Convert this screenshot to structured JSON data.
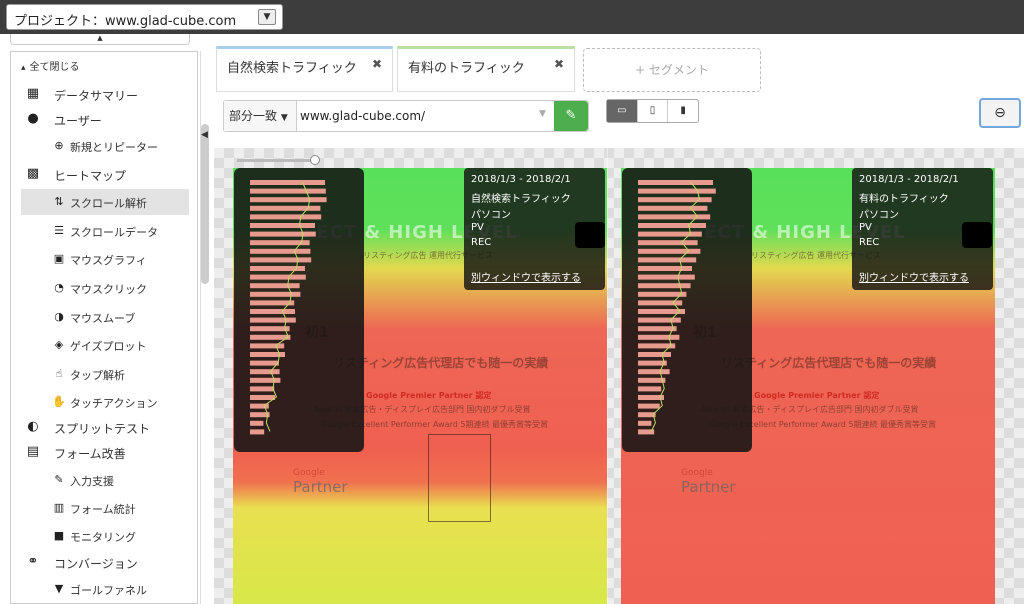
{
  "project_selector": {
    "label": "プロジェクト：www.glad-cube.com"
  },
  "sidebar": {
    "collapse_all": "全て閉じる",
    "items": [
      {
        "label": "データサマリー",
        "icon": "building-icon"
      },
      {
        "label": "ユーザー",
        "icon": "user-icon"
      },
      {
        "label": "新規とリピーター",
        "icon": "user-add-icon"
      },
      {
        "label": "ヒートマップ",
        "icon": "heatmap-icon"
      },
      {
        "label": "スクロール解析",
        "icon": "scroll-icon"
      },
      {
        "label": "スクロールデータ",
        "icon": "scroll-data-icon"
      },
      {
        "label": "マウスグラフィ",
        "icon": "mouse-graph-icon"
      },
      {
        "label": "マウスクリック",
        "icon": "mouse-click-icon"
      },
      {
        "label": "マウスムーブ",
        "icon": "mouse-move-icon"
      },
      {
        "label": "ゲイズプロット",
        "icon": "gaze-icon"
      },
      {
        "label": "タップ解析",
        "icon": "tap-icon"
      },
      {
        "label": "タッチアクション",
        "icon": "touch-icon"
      },
      {
        "label": "スプリットテスト",
        "icon": "toggle-icon"
      },
      {
        "label": "フォーム改善",
        "icon": "form-icon"
      },
      {
        "label": "入力支援",
        "icon": "input-assist-icon"
      },
      {
        "label": "フォーム統計",
        "icon": "form-stats-icon"
      },
      {
        "label": "モニタリング",
        "icon": "monitor-icon"
      },
      {
        "label": "コンバージョン",
        "icon": "handshake-icon"
      },
      {
        "label": "ゴールファネル",
        "icon": "funnel-icon"
      }
    ]
  },
  "segments": {
    "tabs": [
      {
        "label": "自然検索トラフィック",
        "accent": "#a7cfea"
      },
      {
        "label": "有料のトラフィック",
        "accent": "#b8e0a0"
      }
    ],
    "add_label": "+ セグメント"
  },
  "filter": {
    "mode": "部分一致",
    "url": "www.glad-cube.com/"
  },
  "panels": [
    {
      "date": "2018/1/3 - 2018/2/1",
      "segment": "自然検索トラフィック",
      "device": "パソコン",
      "metric1": "PV",
      "metric2": "REC",
      "link": "別ウィンドウで表示する"
    },
    {
      "date": "2018/1/3 - 2018/2/1",
      "segment": "有料のトラフィック",
      "device": "パソコン",
      "metric1": "PV",
      "metric2": "REC",
      "link": "別ウィンドウで表示する"
    }
  ],
  "page_preview": {
    "hero": "FECT & HIGH LEVEL",
    "hero_sub": "リスティング広告 運用代行サービス",
    "headline": "リスティング広告代理店でも随一の実績",
    "premier": "Google Premier Partner 認定",
    "award_line": "Awards 検索広告・ディスプレイ広告部門 国内初ダブル受賞",
    "award_line2": "Google Excellent Performer Award 5期連続 最優秀賞等受賞",
    "partner_brand": "Google",
    "partner_word": "Partner",
    "side_mark": "初1"
  },
  "colors": {
    "accent_green": "#4cae4c",
    "zoom_border": "#6fa8dc",
    "topbar": "#3d3d3d"
  }
}
